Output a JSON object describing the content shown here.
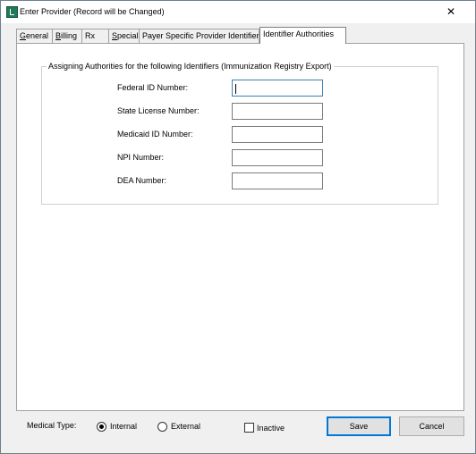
{
  "window": {
    "title": "Enter Provider  (Record will be Changed)",
    "close_glyph": "✕"
  },
  "tabs": [
    {
      "label": "General",
      "underline": "G"
    },
    {
      "label": "Billing",
      "underline": "B"
    },
    {
      "label": "Rx"
    },
    {
      "label": "Special",
      "underline": "S"
    },
    {
      "label": "Payer Specific Provider Identifier"
    },
    {
      "label": "Identifier Authorities",
      "active": true
    }
  ],
  "group": {
    "title": "Assigning Authorities for the following Identifiers (Immunization Registry Export)",
    "fields": [
      {
        "label": "Federal ID Number:",
        "value": ""
      },
      {
        "label": "State License Number:",
        "value": ""
      },
      {
        "label": "Medicaid ID Number:",
        "value": ""
      },
      {
        "label": "NPI Number:",
        "value": ""
      },
      {
        "label": "DEA Number:",
        "value": ""
      }
    ]
  },
  "footer": {
    "medical_type_label": "Medical Type:",
    "radio_internal": "Internal",
    "radio_external": "External",
    "selected": "Internal",
    "inactive_label": "Inactive",
    "inactive_checked": false,
    "save_label": "Save",
    "cancel_label": "Cancel"
  },
  "colors": {
    "accent": "#0078d7",
    "focus_border": "#3c7fb1",
    "panel_bg": "#ffffff",
    "window_bg": "#f0f0f0"
  }
}
